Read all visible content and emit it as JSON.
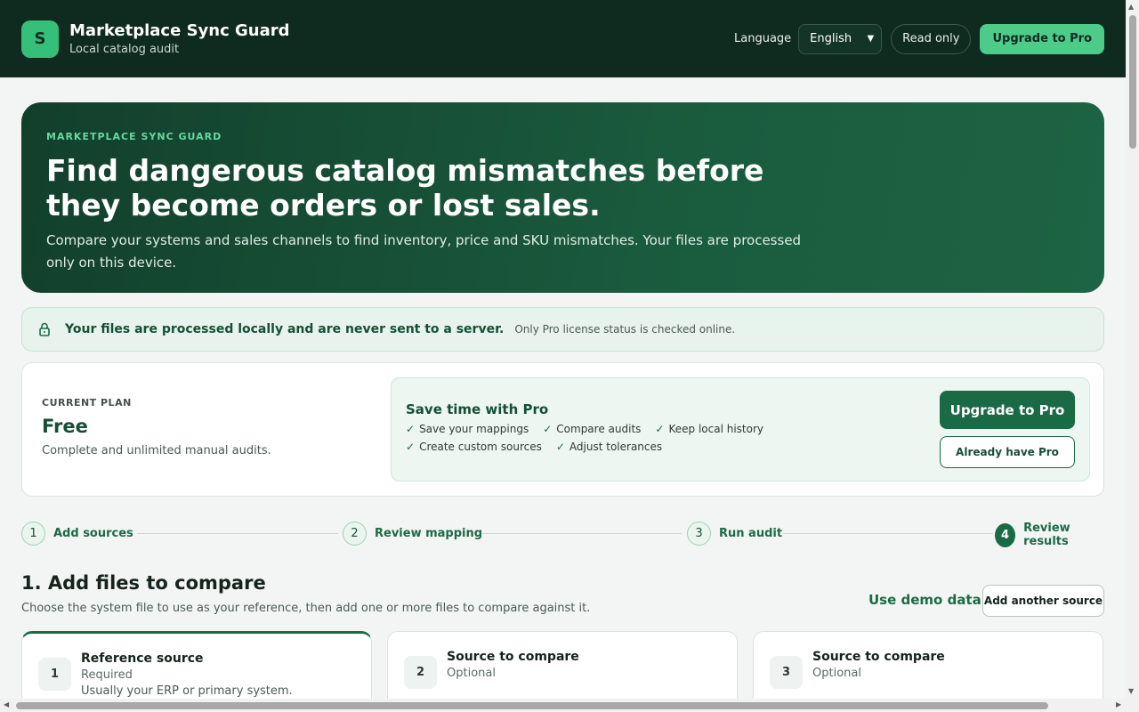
{
  "header": {
    "logo_letter": "S",
    "title": "Marketplace Sync Guard",
    "subtitle": "Local catalog audit",
    "language_label": "Language",
    "language_value": "English",
    "readonly_label": "Read only",
    "upgrade_label": "Upgrade to Pro"
  },
  "hero": {
    "kicker": "MARKETPLACE SYNC GUARD",
    "title": "Find dangerous catalog mismatches before they become orders or lost sales.",
    "description": "Compare your systems and sales channels to find inventory, price and SKU mismatches. Your files are processed only on this device."
  },
  "privacy": {
    "strong": "Your files are processed locally and are never sent to a server.",
    "note": "Only Pro license status is checked online."
  },
  "plan": {
    "kicker": "CURRENT PLAN",
    "name": "Free",
    "description": "Complete and unlimited manual audits.",
    "pro_title": "Save time with Pro",
    "features": [
      "Save your mappings",
      "Compare audits",
      "Keep local history",
      "Create custom sources",
      "Adjust tolerances"
    ],
    "upgrade_label": "Upgrade to Pro",
    "have_pro_label": "Already have Pro"
  },
  "steps": [
    {
      "num": "1",
      "label": "Add sources"
    },
    {
      "num": "2",
      "label": "Review mapping"
    },
    {
      "num": "3",
      "label": "Run audit"
    },
    {
      "num": "4",
      "label": "Review results"
    }
  ],
  "section": {
    "title": "1. Add files to compare",
    "description": "Choose the system file to use as your reference, then add one or more files to compare against it.",
    "demo_label": "Use demo data",
    "add_source_label": "Add another source"
  },
  "sources": [
    {
      "num": "1",
      "title": "Reference source",
      "requirement": "Required",
      "hint": "Usually your ERP or primary system."
    },
    {
      "num": "2",
      "title": "Source to compare",
      "requirement": "Optional",
      "hint": ""
    },
    {
      "num": "3",
      "title": "Source to compare",
      "requirement": "Optional",
      "hint": ""
    }
  ],
  "colors": {
    "header_bg": "#0f2a1f",
    "accent": "#1b6a46",
    "accent_light": "#4ccb89",
    "hero_bg": "#174d35"
  }
}
